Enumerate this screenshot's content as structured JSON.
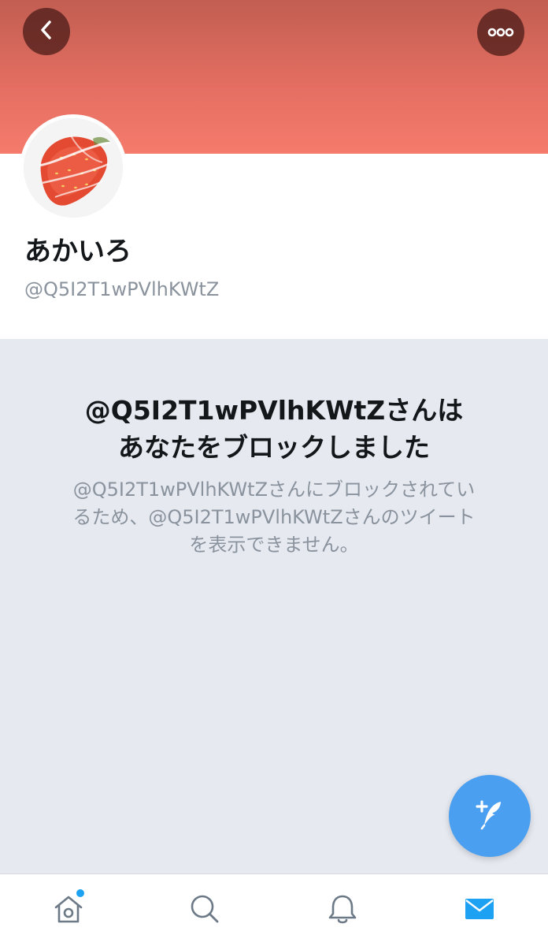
{
  "profile": {
    "display_name": "あかいろ",
    "handle": "@Q5I2T1wPVlhKWtZ"
  },
  "blocked": {
    "title_line1": "@Q5I2T1wPVlhKWtZさんは",
    "title_line2": "あなたをブロックしました",
    "desc_line1": "@Q5I2T1wPVlhKWtZさんにブロックされてい",
    "desc_line2": "るため、@Q5I2T1wPVlhKWtZさんのツイート",
    "desc_line3": "を表示できません。"
  },
  "header": {
    "back_icon": "chevron-left-icon",
    "more_icon": "more-dots-icon"
  },
  "tabs": [
    {
      "name": "home",
      "icon": "home-icon",
      "has_notification_dot": true
    },
    {
      "name": "search",
      "icon": "search-icon"
    },
    {
      "name": "notifications",
      "icon": "bell-icon"
    },
    {
      "name": "messages",
      "icon": "envelope-icon",
      "active": true
    }
  ],
  "colors": {
    "accent": "#1da1f2",
    "fab": "#4a9ff0",
    "banner_top": "#c25e52",
    "banner_bottom": "#f57b6c",
    "muted_text": "#8a939d",
    "background": "#e6e9f0"
  }
}
